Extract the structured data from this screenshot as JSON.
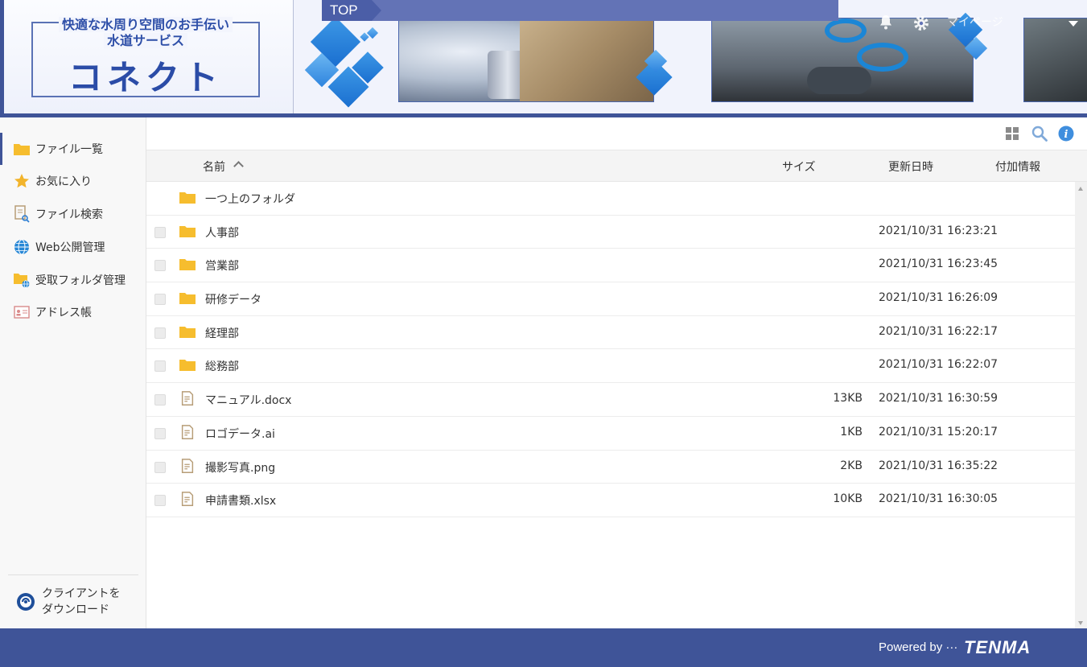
{
  "header": {
    "tagline_line1": "快適な水周り空間のお手伝い",
    "tagline_line2": "水道サービス",
    "brand": "コネクト",
    "top_label": "TOP",
    "mypage_label": "マイページ"
  },
  "colors": {
    "primary": "#3f5498",
    "folder": "#f6bd2e",
    "accent_blue": "#1f7fd8"
  },
  "sidebar": {
    "items": [
      {
        "label": "ファイル一覧",
        "icon": "folder-icon"
      },
      {
        "label": "お気に入り",
        "icon": "star-icon"
      },
      {
        "label": "ファイル検索",
        "icon": "file-search-icon"
      },
      {
        "label": "Web公開管理",
        "icon": "globe-icon"
      },
      {
        "label": "受取フォルダ管理",
        "icon": "folder-globe-icon"
      },
      {
        "label": "アドレス帳",
        "icon": "address-card-icon"
      }
    ],
    "client_download_line1": "クライアントを",
    "client_download_line2": "ダウンロード"
  },
  "table": {
    "columns": {
      "name": "名前",
      "size": "サイズ",
      "modified": "更新日時",
      "info": "付加情報"
    },
    "parent_folder": "一つ上のフォルダ",
    "rows": [
      {
        "name": "人事部",
        "type": "folder",
        "size": "",
        "date": "2021/10/31 16:23:21"
      },
      {
        "name": "営業部",
        "type": "folder",
        "size": "",
        "date": "2021/10/31 16:23:45"
      },
      {
        "name": "研修データ",
        "type": "folder",
        "size": "",
        "date": "2021/10/31 16:26:09"
      },
      {
        "name": "経理部",
        "type": "folder",
        "size": "",
        "date": "2021/10/31 16:22:17"
      },
      {
        "name": "総務部",
        "type": "folder",
        "size": "",
        "date": "2021/10/31 16:22:07"
      },
      {
        "name": "マニュアル.docx",
        "type": "file",
        "size": "13KB",
        "date": "2021/10/31 16:30:59"
      },
      {
        "name": "ロゴデータ.ai",
        "type": "file",
        "size": "1KB",
        "date": "2021/10/31 15:20:17"
      },
      {
        "name": "撮影写真.png",
        "type": "file",
        "size": "2KB",
        "date": "2021/10/31 16:35:22"
      },
      {
        "name": "申請書類.xlsx",
        "type": "file",
        "size": "10KB",
        "date": "2021/10/31 16:30:05"
      }
    ]
  },
  "footer": {
    "powered_by": "Powered by ···",
    "brand": "TENMA"
  }
}
